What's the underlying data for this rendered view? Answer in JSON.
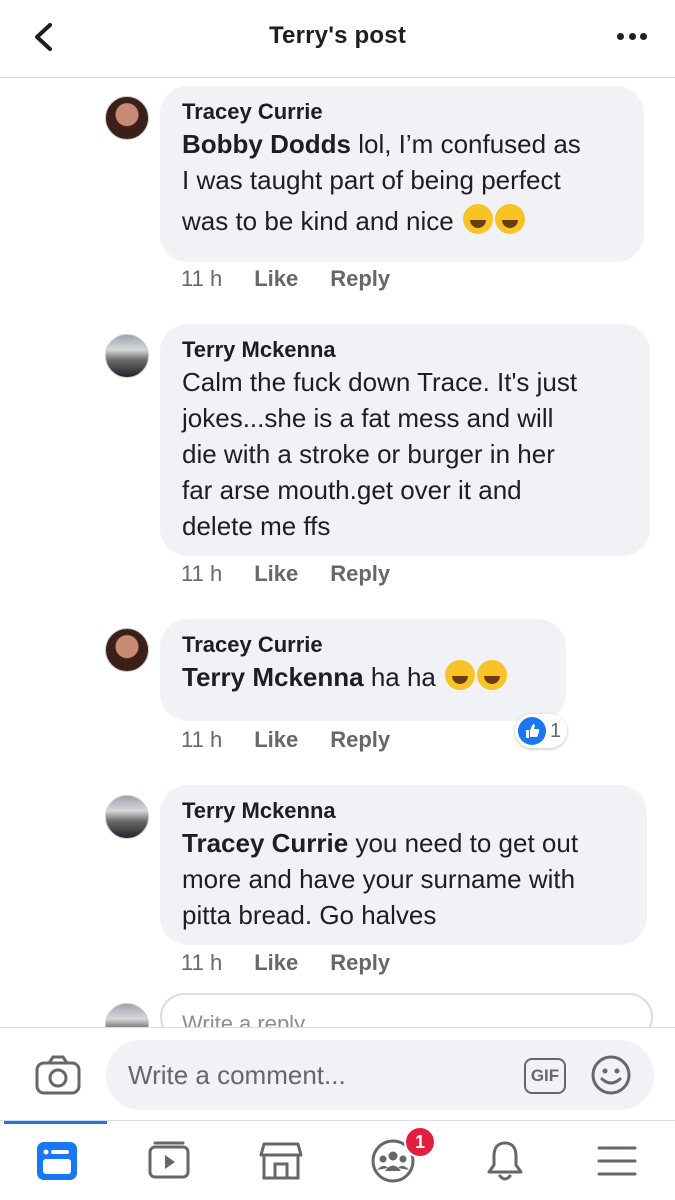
{
  "header": {
    "title": "Terry's post"
  },
  "comments": [
    {
      "author": "Tracey Currie",
      "mention": "Bobby Dodds",
      "text_lines": [
        " lol, I’m confused as",
        "I was taught part of being perfect",
        "was to be kind and nice"
      ],
      "time": "11 h",
      "like_label": "Like",
      "reply_label": "Reply"
    },
    {
      "author": "Terry Mckenna",
      "text_lines": [
        "Calm the fuck down Trace. It's just",
        "jokes...she is a fat mess and will",
        "die with a stroke or burger in her",
        "far arse mouth.get over it and",
        "delete me ffs"
      ],
      "time": "11 h",
      "like_label": "Like",
      "reply_label": "Reply"
    },
    {
      "author": "Tracey Currie",
      "mention": "Terry Mckenna",
      "text": " ha ha",
      "time": "11 h",
      "like_label": "Like",
      "reply_label": "Reply",
      "reaction_count": "1"
    },
    {
      "author": "Terry Mckenna",
      "mention": "Tracey Currie",
      "text_lines": [
        " you need to get out",
        "more and have your surname with",
        "pitta bread. Go halves"
      ],
      "time": "11 h",
      "like_label": "Like",
      "reply_label": "Reply"
    }
  ],
  "reply_box": {
    "placeholder": "Write a reply..."
  },
  "composer": {
    "placeholder": "Write a comment...",
    "gif_label": "GIF"
  },
  "tabbar": {
    "groups_badge": "1"
  },
  "colors": {
    "accent": "#1877f2",
    "bubble": "#f0f2f5",
    "badge": "#e41e3f"
  }
}
